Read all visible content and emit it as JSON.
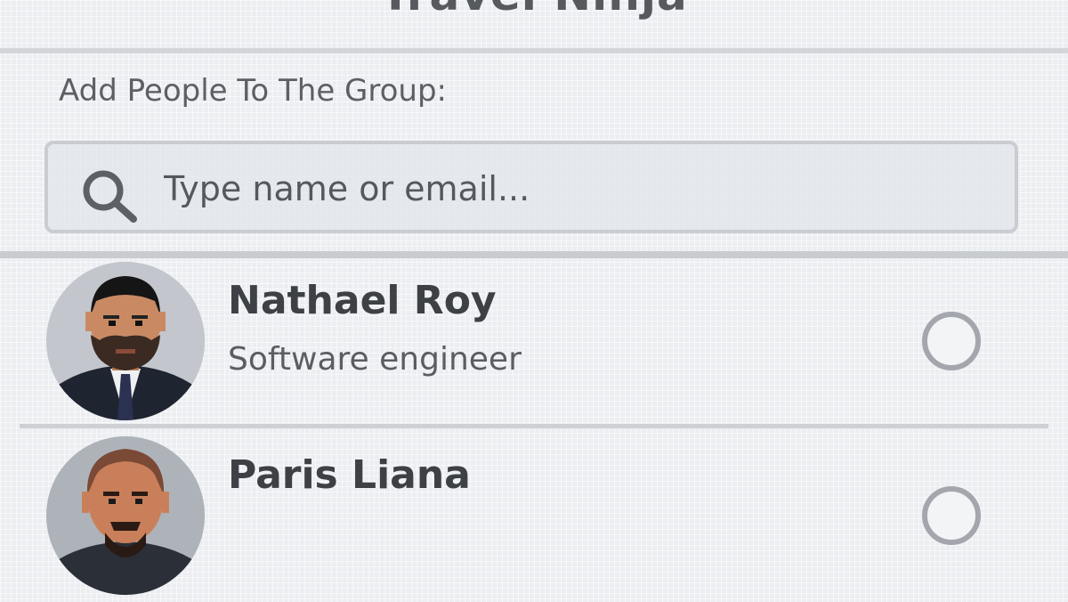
{
  "header": {
    "title": "Travel Ninja"
  },
  "group": {
    "label": "Add People To The Group:",
    "search": {
      "placeholder": "Type name or email...",
      "value": "",
      "icon": "search-icon"
    }
  },
  "people": [
    {
      "name": "Nathael Roy",
      "role": "Software engineer",
      "selected": false,
      "avatar": "avatar-photo"
    },
    {
      "name": "Paris Liana",
      "role": "",
      "selected": false,
      "avatar": "avatar-photo"
    }
  ],
  "colors": {
    "background": "#eceef1",
    "text": "#3f4246",
    "muted": "#5a5d61",
    "border": "#c9ccd1"
  }
}
